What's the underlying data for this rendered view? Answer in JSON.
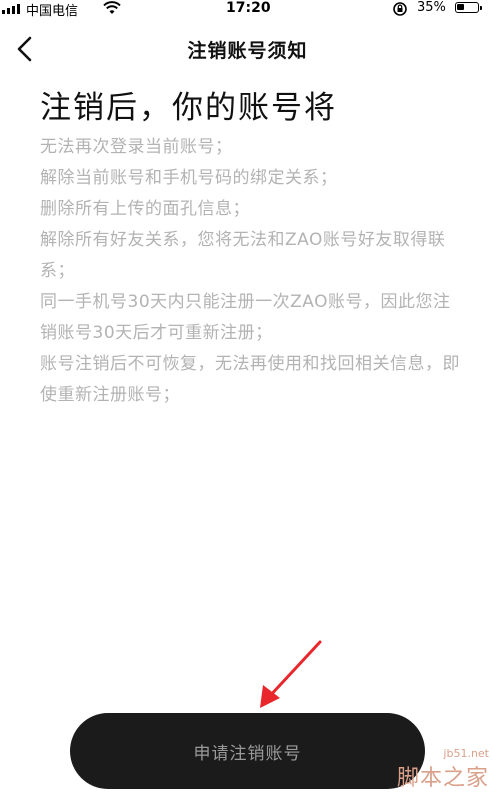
{
  "status_bar": {
    "carrier": "中国电信",
    "time": "17:20",
    "battery": "35%",
    "battery_level": 0.35,
    "icons": [
      "signal-icon",
      "wifi-icon",
      "rotation-lock-icon",
      "battery-icon"
    ]
  },
  "nav": {
    "back_icon": "chevron-left-icon",
    "title": "注销账号须知"
  },
  "content": {
    "headline": "注销后，你的账号将",
    "notes": [
      "无法再次登录当前账号；",
      "解除当前账号和手机号码的绑定关系；",
      "删除所有上传的面孔信息；",
      "解除所有好友关系，您将无法和ZAO账号好友取得联系；",
      "同一手机号30天内只能注册一次ZAO账号，因此您注销账号30天后才可重新注册；",
      "账号注销后不可恢复，无法再使用和找回相关信息，即使重新注册账号；"
    ]
  },
  "action": {
    "apply_label": "申请注销账号"
  },
  "annotation": {
    "arrow_color": "#e8262c"
  },
  "watermark": {
    "site": "jb51.net",
    "brand": "脚本之家"
  }
}
